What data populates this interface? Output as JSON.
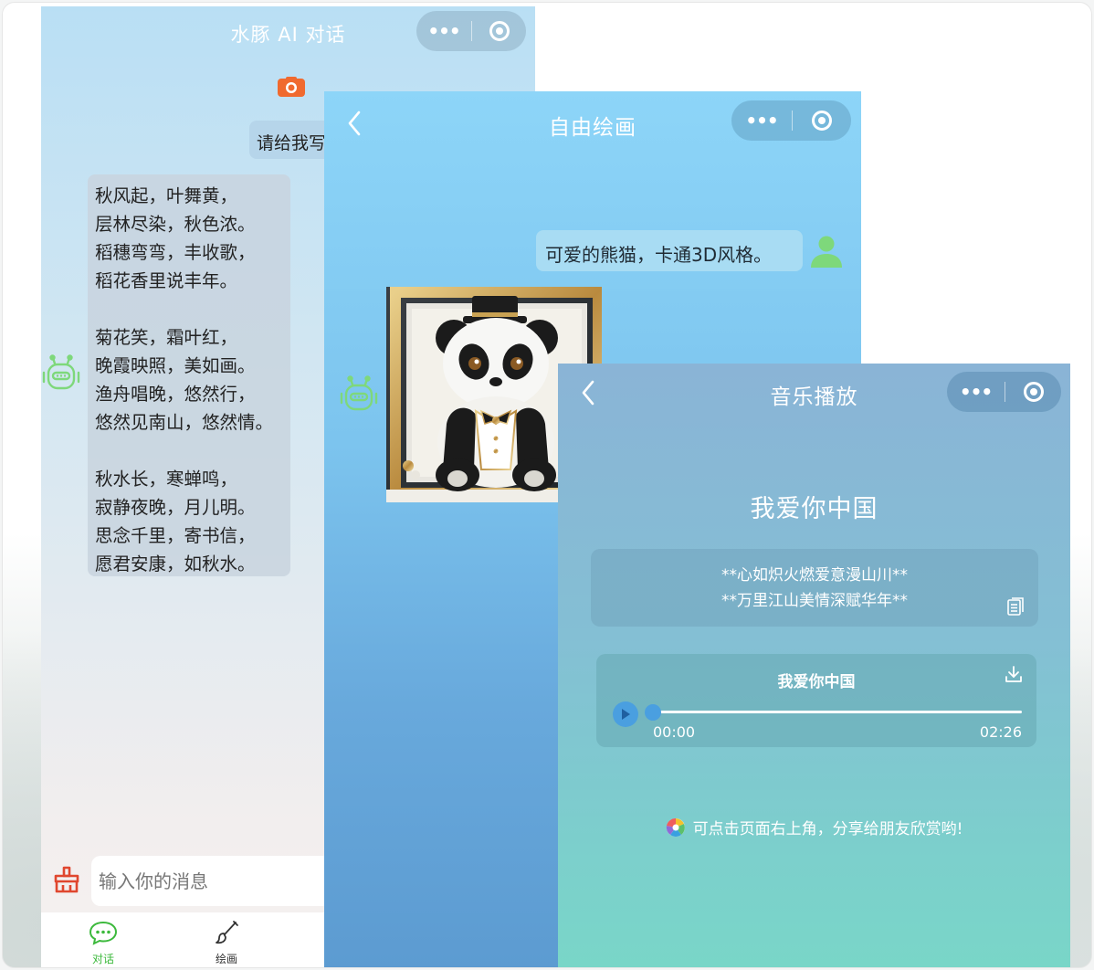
{
  "chat": {
    "title": "水豚 AI 对话",
    "user_message": "请给我写",
    "poem": {
      "stanza1": [
        "秋风起，叶舞黄，",
        "层林尽染，秋色浓。",
        "稻穗弯弯，丰收歌，",
        "稻花香里说丰年。"
      ],
      "stanza2": [
        "菊花笑，霜叶红，",
        "晚霞映照，美如画。",
        "渔舟唱晚，悠然行，",
        "悠然见南山，悠然情。"
      ],
      "stanza3": [
        "秋水长，寒蝉鸣，",
        "寂静夜晚，月儿明。",
        "思念千里，寄书信，",
        "愿君安康，如秋水。"
      ]
    },
    "input_placeholder": "输入你的消息",
    "tabs": [
      {
        "label": "对话",
        "color": "#3cb93c"
      },
      {
        "label": "绘画",
        "color": "#333333"
      }
    ]
  },
  "draw": {
    "title": "自由绘画",
    "user_message": "可爱的熊猫，卡通3D风格。"
  },
  "music": {
    "title": "音乐播放",
    "song_title": "我爱你中国",
    "lyrics": [
      "**心如炽火燃爱意漫山川**",
      "**万里江山美情深赋华年**"
    ],
    "player": {
      "track": "我爱你中国",
      "current_time": "00:00",
      "total_time": "02:26",
      "progress_fraction": 0.0
    },
    "share_hint": "可点击页面右上角，分享给朋友欣赏哟!"
  },
  "colors": {
    "bot_green": "#7ed87b",
    "accent_blue": "#4a9fe0",
    "camera_orange": "#f06a2f",
    "broom_red": "#e0472f"
  }
}
